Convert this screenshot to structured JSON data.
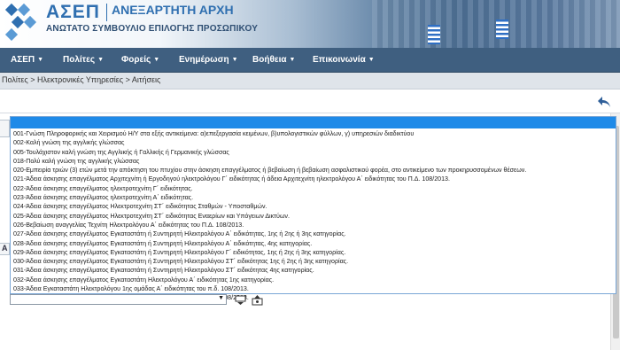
{
  "header": {
    "logo_text": "ΑΣΕΠ",
    "subtitle_main": "ΑΝΕΞΑΡΤΗΤΗ ΑΡΧΗ",
    "subtitle_small": "ΑΝΩΤΑΤΟ ΣΥΜΒΟΥΛΙΟ ΕΠΙΛΟΓΗΣ ΠΡΟΣΩΠΙΚΟΥ"
  },
  "nav": {
    "items": [
      {
        "label": "ΑΣΕΠ"
      },
      {
        "label": "Πολίτες"
      },
      {
        "label": "Φορείς"
      },
      {
        "label": "Ενημέρωση"
      },
      {
        "label": "Βοήθεια"
      },
      {
        "label": "Επικοινωνία"
      }
    ]
  },
  "breadcrumb": {
    "items": [
      "Πολίτες",
      "Ηλεκτρονικές Υπηρεσίες",
      "Αιτήσεις"
    ],
    "separator": " > "
  },
  "dropdown": {
    "selected_value": "",
    "options": [
      "001-Γνώση Πληροφορικής και Χειρισμού Η/Υ στα εξής αντικείμενα: α)επεξεργασία κειμένων, β)υπολογιστικών φύλλων, γ) υπηρεσιών διαδικτύου",
      "002-Καλή γνώση της αγγλικής γλώσσας",
      "005-Τουλάχιστον καλή γνώση της Αγγλικής ή Γαλλικής ή Γερμανικής γλώσσας",
      "018-Πολύ καλή γνώση της αγγλικής γλώσσας",
      "020-Εμπειρία τριών (3) ετών μετά την απόκτηση του πτυχίου στην άσκηση επαγγέλματος ή βεβαίωση ή βεβαίωση ασφαλιστικού φορέα, στο αντικείμενο των προκηρυσσομένων θέσεων.",
      "021-Άδεια άσκησης επαγγέλματος Αρχιτεχνίτη ή Εργοδηγού ηλεκτρολόγου Γ΄ ειδικότητας ή άδεια Αρχιτεχνίτη ηλεκτρολόγου Α΄ ειδικότητας του Π.Δ. 108/2013.",
      "022-Άδεια άσκησης επαγγέλματος ηλεκτροτεχνίτη Γ΄ ειδικότητας.",
      "023-Άδεια άσκησης επαγγέλματος ηλεκτροτεχνίτη Α΄ ειδικότητας.",
      "024-Άδεια άσκησης επαγγέλματος Ηλεκτροτεχνίτη ΣΤ΄ ειδικότητας Σταθμών - Υποσταθμών.",
      "025-Άδεια άσκησης επαγγέλματος Ηλεκτροτεχνίτη ΣΤ΄ ειδικότητας Εναερίων και Υπόγειων Δικτύων.",
      "026-Βεβαίωση αναγγελίας Τεχνίτη Ηλεκτρολόγου Α΄ ειδικότητας του Π.Δ. 108/2013.",
      "027-Άδεια άσκησης επαγγέλματος Εγκαταστάτη ή Συντηρητή Ηλεκτρολόγου Α΄ ειδικότητας, 1ης ή 2ης ή 3ης κατηγορίας.",
      "028-Άδεια άσκησης επαγγέλματος Εγκαταστάτη ή Συντηρητή Ηλεκτρολόγου Α΄ ειδικότητας, 4ης κατηγορίας.",
      "029-Άδεια άσκησης επαγγέλματος Εγκαταστάτη ή Συντηρητή Ηλεκτρολόγου Γ΄ ειδικότητας, 1ης ή 2ης ή 3ης κατηγορίας.",
      "030-Άδεια άσκησης επαγγέλματος Εγκαταστάτη ή Συντηρητή Ηλεκτρολόγου ΣΤ΄ ειδικότητας 1ης ή 2ης ή 3ης κατηγορίας.",
      "031-Άδεια άσκησης επαγγέλματος Εγκαταστάτη ή Συντηρητή Ηλεκτρολόγου ΣΤ΄ ειδικότητας 4ης κατηγορίας.",
      "032-Άδεια άσκησης επαγγέλματος Εγκαταστάτη Ηλεκτρολόγου Α΄ ειδικότητας 1ης κατηγορίας.",
      "033-Άδεια Εγκαταστάτη Ηλεκτρολόγου 1ης ομάδας Α΄ ειδικότητας του π.δ. 108/2013.",
      "034-Άδεια Εγκαταστάτη Ηλεκτρολόγου 2ης ομάδας Α΄ ειδικότητας του π.δ. 108/2013."
    ]
  },
  "page": {
    "left_tab_label": "A",
    "select_value": ""
  },
  "colors": {
    "nav_bg": "#3f5f80",
    "brand_blue": "#2f6fb0",
    "highlight": "#1e8ae8"
  }
}
